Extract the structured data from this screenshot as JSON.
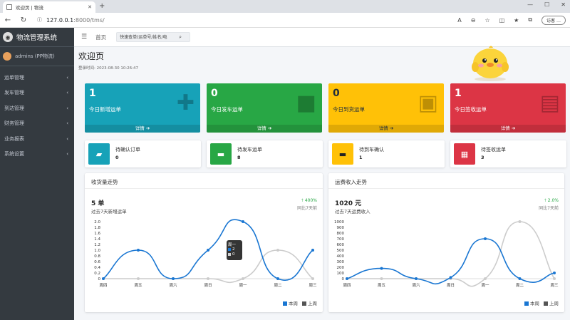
{
  "browser": {
    "tab_title": "欢迎页 | 物流",
    "url_host": "127.0.0.1",
    "url_rest": ":8000/tms/",
    "guest_label": "访客"
  },
  "sidebar": {
    "brand": "物流管理系统",
    "user": "admins (PP物流)",
    "items": [
      {
        "label": "运单管理"
      },
      {
        "label": "发车管理"
      },
      {
        "label": "到达管理"
      },
      {
        "label": "财务管理"
      },
      {
        "label": "业务报表"
      },
      {
        "label": "系统设置"
      }
    ]
  },
  "topnav": {
    "home": "首页",
    "search_placeholder": "快速查单(运单号/姓名/电"
  },
  "page": {
    "title": "欢迎页",
    "login_time": "登录时间: 2023-08-30 10:26:47"
  },
  "info_boxes": [
    {
      "value": "1",
      "label": "今日新增运单",
      "footer": "详情",
      "color": "#17a2b8",
      "icon": "clipboard-icon"
    },
    {
      "value": "0",
      "label": "今日发车运单",
      "footer": "详情",
      "color": "#28a745",
      "icon": "truck-icon"
    },
    {
      "value": "0",
      "label": "今日到货运单",
      "footer": "详情",
      "color": "#ffc107",
      "icon": "dolly-icon"
    },
    {
      "value": "1",
      "label": "今日签收运单",
      "footer": "详情",
      "color": "#dc3545",
      "icon": "box-open-icon"
    }
  ],
  "small_boxes": [
    {
      "title": "待确认订单",
      "value": "0",
      "color": "#17a2b8",
      "icon": "folder-open-icon"
    },
    {
      "title": "待发车运单",
      "value": "8",
      "color": "#28a745",
      "icon": "car-icon"
    },
    {
      "title": "待到车确认",
      "value": "1",
      "color": "#ffc107",
      "icon": "car-front-icon"
    },
    {
      "title": "待签收运单",
      "value": "3",
      "color": "#dc3545",
      "icon": "box-icon"
    }
  ],
  "tooltip": {
    "day": "周一",
    "v1": "2",
    "v2": "0"
  },
  "chart_data": [
    {
      "type": "line",
      "title": "收货量走势",
      "headline": "5 单",
      "subtitle": "过去7天新增运单",
      "change": "400%",
      "compare": "同比7天前",
      "categories": [
        "周四",
        "周五",
        "周六",
        "周日",
        "周一",
        "周二",
        "周三"
      ],
      "series": [
        {
          "name": "本周",
          "values": [
            0,
            1,
            0,
            1,
            2,
            0,
            1
          ],
          "color": "#1976d2"
        },
        {
          "name": "上周",
          "values": [
            0,
            0,
            0,
            0,
            0,
            1,
            0
          ],
          "color": "#cccccc"
        }
      ],
      "yticks": [
        "0",
        "0.2",
        "0.4",
        "0.6",
        "0.8",
        "1.0",
        "1.2",
        "1.4",
        "1.6",
        "1.8",
        "2.0"
      ],
      "ylim": [
        0,
        2
      ]
    },
    {
      "type": "line",
      "title": "运费收入走势",
      "headline": "1020 元",
      "subtitle": "过去7天运费收入",
      "change": "2.0%",
      "compare": "同比7天前",
      "categories": [
        "周四",
        "周五",
        "周六",
        "周日",
        "周一",
        "周二",
        "周三"
      ],
      "series": [
        {
          "name": "本周",
          "values": [
            0,
            180,
            0,
            20,
            700,
            0,
            100
          ],
          "color": "#1976d2"
        },
        {
          "name": "上周",
          "values": [
            0,
            0,
            0,
            0,
            0,
            1000,
            0
          ],
          "color": "#cccccc"
        }
      ],
      "yticks": [
        "0",
        "100",
        "200",
        "300",
        "400",
        "500",
        "600",
        "700",
        "800",
        "900",
        "1000"
      ],
      "ylim": [
        0,
        1000
      ]
    }
  ]
}
